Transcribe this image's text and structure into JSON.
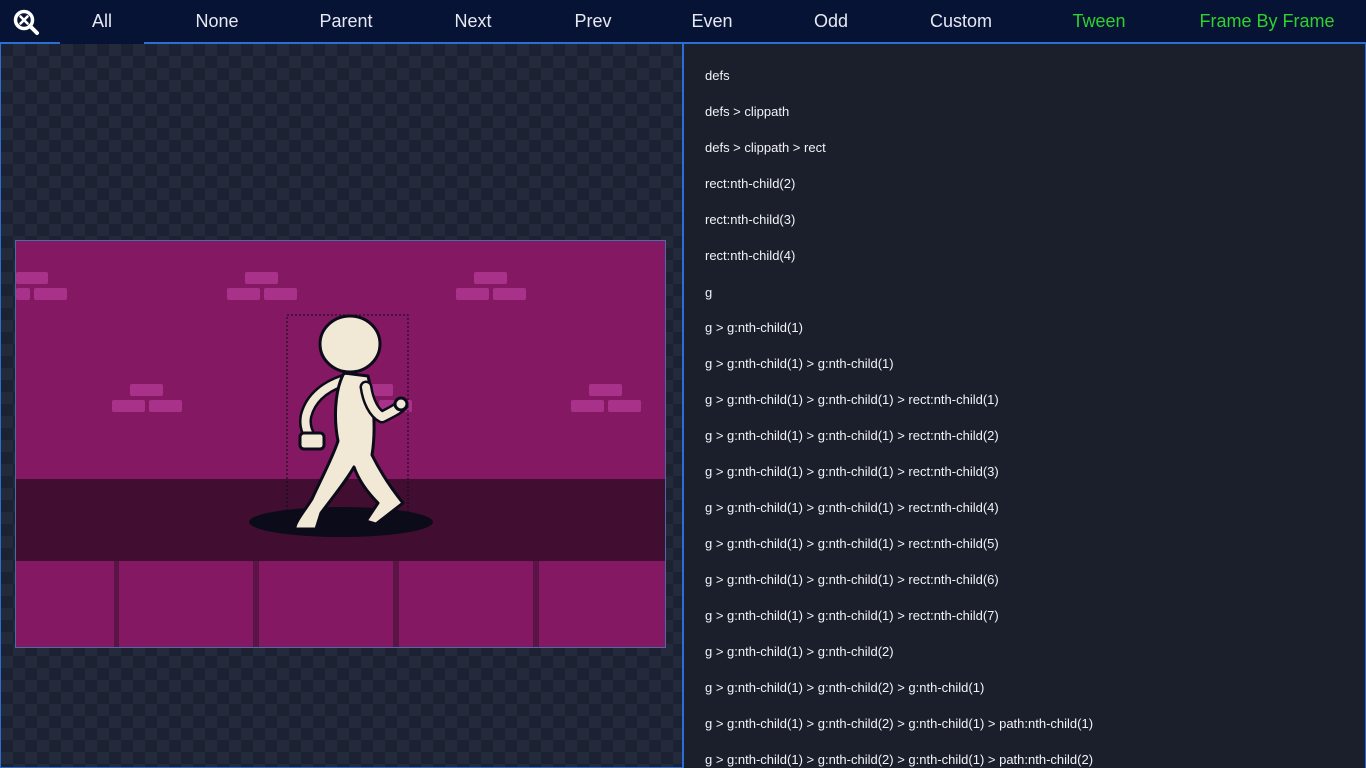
{
  "toolbar": {
    "zoom_icon": "zoom-reset-icon",
    "nav": [
      {
        "label": "All",
        "active": true
      },
      {
        "label": "None"
      },
      {
        "label": "Parent"
      },
      {
        "label": "Next"
      },
      {
        "label": "Prev"
      },
      {
        "label": "Even"
      },
      {
        "label": "Odd"
      },
      {
        "label": "Custom"
      },
      {
        "label": "Tween",
        "color": "#2fd12f"
      },
      {
        "label": "Frame By Frame",
        "color": "#2fd12f"
      }
    ]
  },
  "selectors": [
    "defs",
    "defs > clippath",
    "defs > clippath > rect",
    "rect:nth-child(2)",
    "rect:nth-child(3)",
    "rect:nth-child(4)",
    "g",
    "g > g:nth-child(1)",
    "g > g:nth-child(1) > g:nth-child(1)",
    "g > g:nth-child(1) > g:nth-child(1) > rect:nth-child(1)",
    "g > g:nth-child(1) > g:nth-child(1) > rect:nth-child(2)",
    "g > g:nth-child(1) > g:nth-child(1) > rect:nth-child(3)",
    "g > g:nth-child(1) > g:nth-child(1) > rect:nth-child(4)",
    "g > g:nth-child(1) > g:nth-child(1) > rect:nth-child(5)",
    "g > g:nth-child(1) > g:nth-child(1) > rect:nth-child(6)",
    "g > g:nth-child(1) > g:nth-child(1) > rect:nth-child(7)",
    "g > g:nth-child(1) > g:nth-child(2)",
    "g > g:nth-child(1) > g:nth-child(2) > g:nth-child(1)",
    "g > g:nth-child(1) > g:nth-child(2) > g:nth-child(1) > path:nth-child(1)",
    "g > g:nth-child(1) > g:nth-child(2) > g:nth-child(1) > path:nth-child(2)"
  ],
  "colors": {
    "toolbar_bg": "#071335",
    "accent_border": "#2a6fd6",
    "green_label": "#2fd12f",
    "scene_wall": "#851862",
    "scene_brick": "#a8318a",
    "scene_floor": "#410e31",
    "character_fill": "#f2e8d6",
    "character_outline": "#0b0b1a"
  }
}
